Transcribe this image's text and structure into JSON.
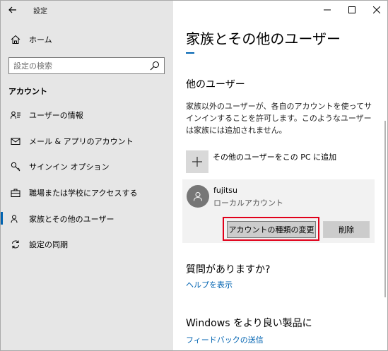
{
  "titlebar": {
    "app_title": "設定"
  },
  "sidebar": {
    "home_label": "ホーム",
    "search_placeholder": "設定の検索",
    "section_label": "アカウント",
    "items": [
      {
        "label": "ユーザーの情報",
        "icon": "user-info-icon"
      },
      {
        "label": "メール & アプリのアカウント",
        "icon": "mail-icon"
      },
      {
        "label": "サインイン オプション",
        "icon": "key-icon"
      },
      {
        "label": "職場または学校にアクセスする",
        "icon": "briefcase-icon"
      },
      {
        "label": "家族とその他のユーザー",
        "icon": "people-icon",
        "active": true
      },
      {
        "label": "設定の同期",
        "icon": "sync-icon"
      }
    ]
  },
  "main": {
    "page_title": "家族とその他のユーザー",
    "other_users_title": "他のユーザー",
    "description": "家族以外のユーザーが、各自のアカウントを使ってサインインすることを許可します。このようなユーザーは家族には追加されません。",
    "add_user_label": "その他のユーザーをこの PC に追加",
    "user": {
      "name": "fujitsu",
      "type": "ローカルアカウント",
      "change_type_label": "アカウントの種類の変更",
      "delete_label": "削除"
    },
    "question_title": "質問がありますか?",
    "help_link": "ヘルプを表示",
    "improve_title": "Windows をより良い製品に",
    "feedback_link": "フィードバックの送信"
  },
  "colors": {
    "accent": "#0063b1",
    "highlight": "#e0001a",
    "sidebar_bg": "#e6e6e6"
  }
}
